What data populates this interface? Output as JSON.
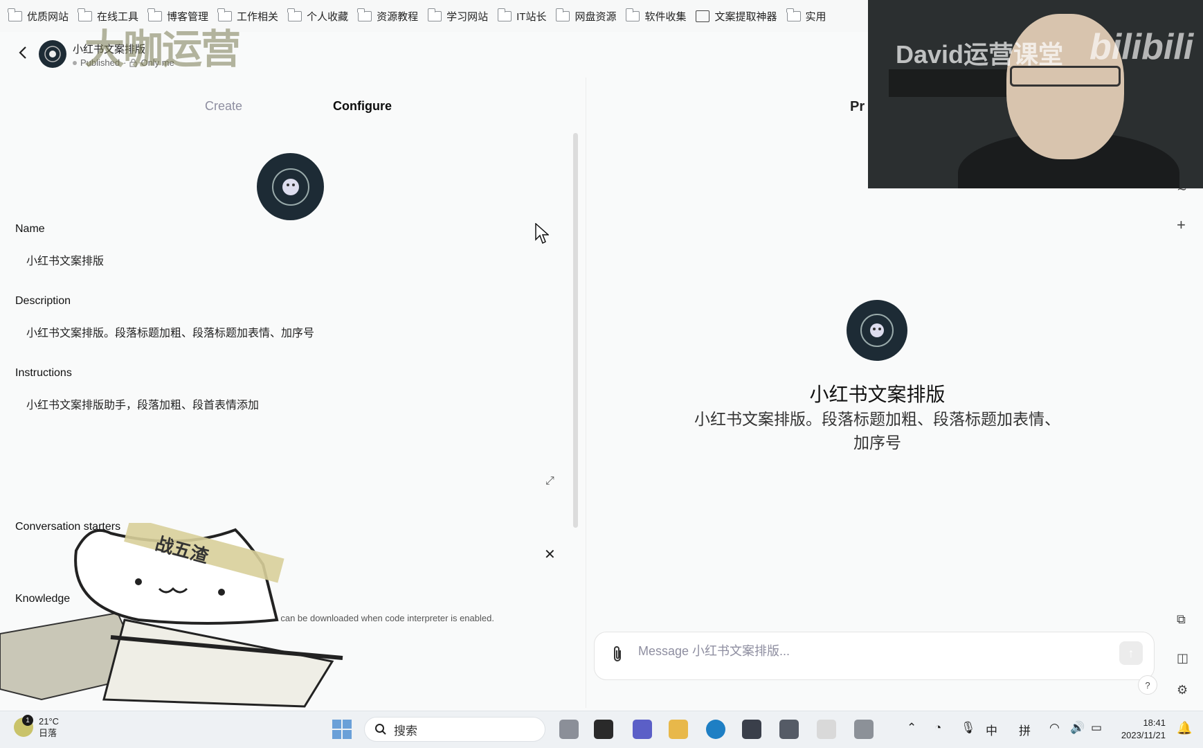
{
  "bookmarks": [
    {
      "label": "优质网站",
      "icon": "folder-icon"
    },
    {
      "label": "在线工具",
      "icon": "folder-icon"
    },
    {
      "label": "博客管理",
      "icon": "folder-icon"
    },
    {
      "label": "工作相关",
      "icon": "folder-icon"
    },
    {
      "label": "个人收藏",
      "icon": "folder-icon"
    },
    {
      "label": "资源教程",
      "icon": "folder-icon"
    },
    {
      "label": "学习网站",
      "icon": "folder-icon"
    },
    {
      "label": "IT站长",
      "icon": "folder-icon"
    },
    {
      "label": "网盘资源",
      "icon": "folder-icon"
    },
    {
      "label": "软件收集",
      "icon": "folder-icon"
    },
    {
      "label": "文案提取神器",
      "icon": "app-icon"
    },
    {
      "label": "实用",
      "icon": "folder-icon"
    }
  ],
  "watermark_logo": "大咖运营",
  "header": {
    "title": "小红书文案排版",
    "status": "Published",
    "visibility": "Only me"
  },
  "tabs": {
    "create": "Create",
    "configure": "Configure"
  },
  "form": {
    "name_label": "Name",
    "name_value": "小红书文案排版",
    "description_label": "Description",
    "description_value": "小红书文案排版。段落标题加粗、段落标题加表情、加序号",
    "instructions_label": "Instructions",
    "instructions_value": "小红书文案排版助手，段落加粗、段首表情添加",
    "starters_label": "Conversation starters",
    "knowledge_label": "Knowledge",
    "knowledge_note": "es can be downloaded when code interpreter is enabled."
  },
  "sticker_text": "战五渣",
  "preview": {
    "label": "Pr",
    "title": "小红书文案排版",
    "description": "小红书文案排版。段落标题加粗、段落标题加表情、加序号",
    "message_placeholder": "Message 小红书文案排版..."
  },
  "webcam": {
    "overlay_text": "David运营课堂",
    "brand": "bilibili"
  },
  "taskbar": {
    "weather_temp": "21°C",
    "weather_desc": "日落",
    "weather_badge": "1",
    "search_placeholder": "搜索",
    "ime_lang": "中",
    "ime_mode": "拼",
    "time": "18:41",
    "date": "2023/11/21"
  },
  "colors": {
    "background": "#f9fafa",
    "avatar_bg": "#1d2b35",
    "muted_text": "#8e8ea0"
  }
}
